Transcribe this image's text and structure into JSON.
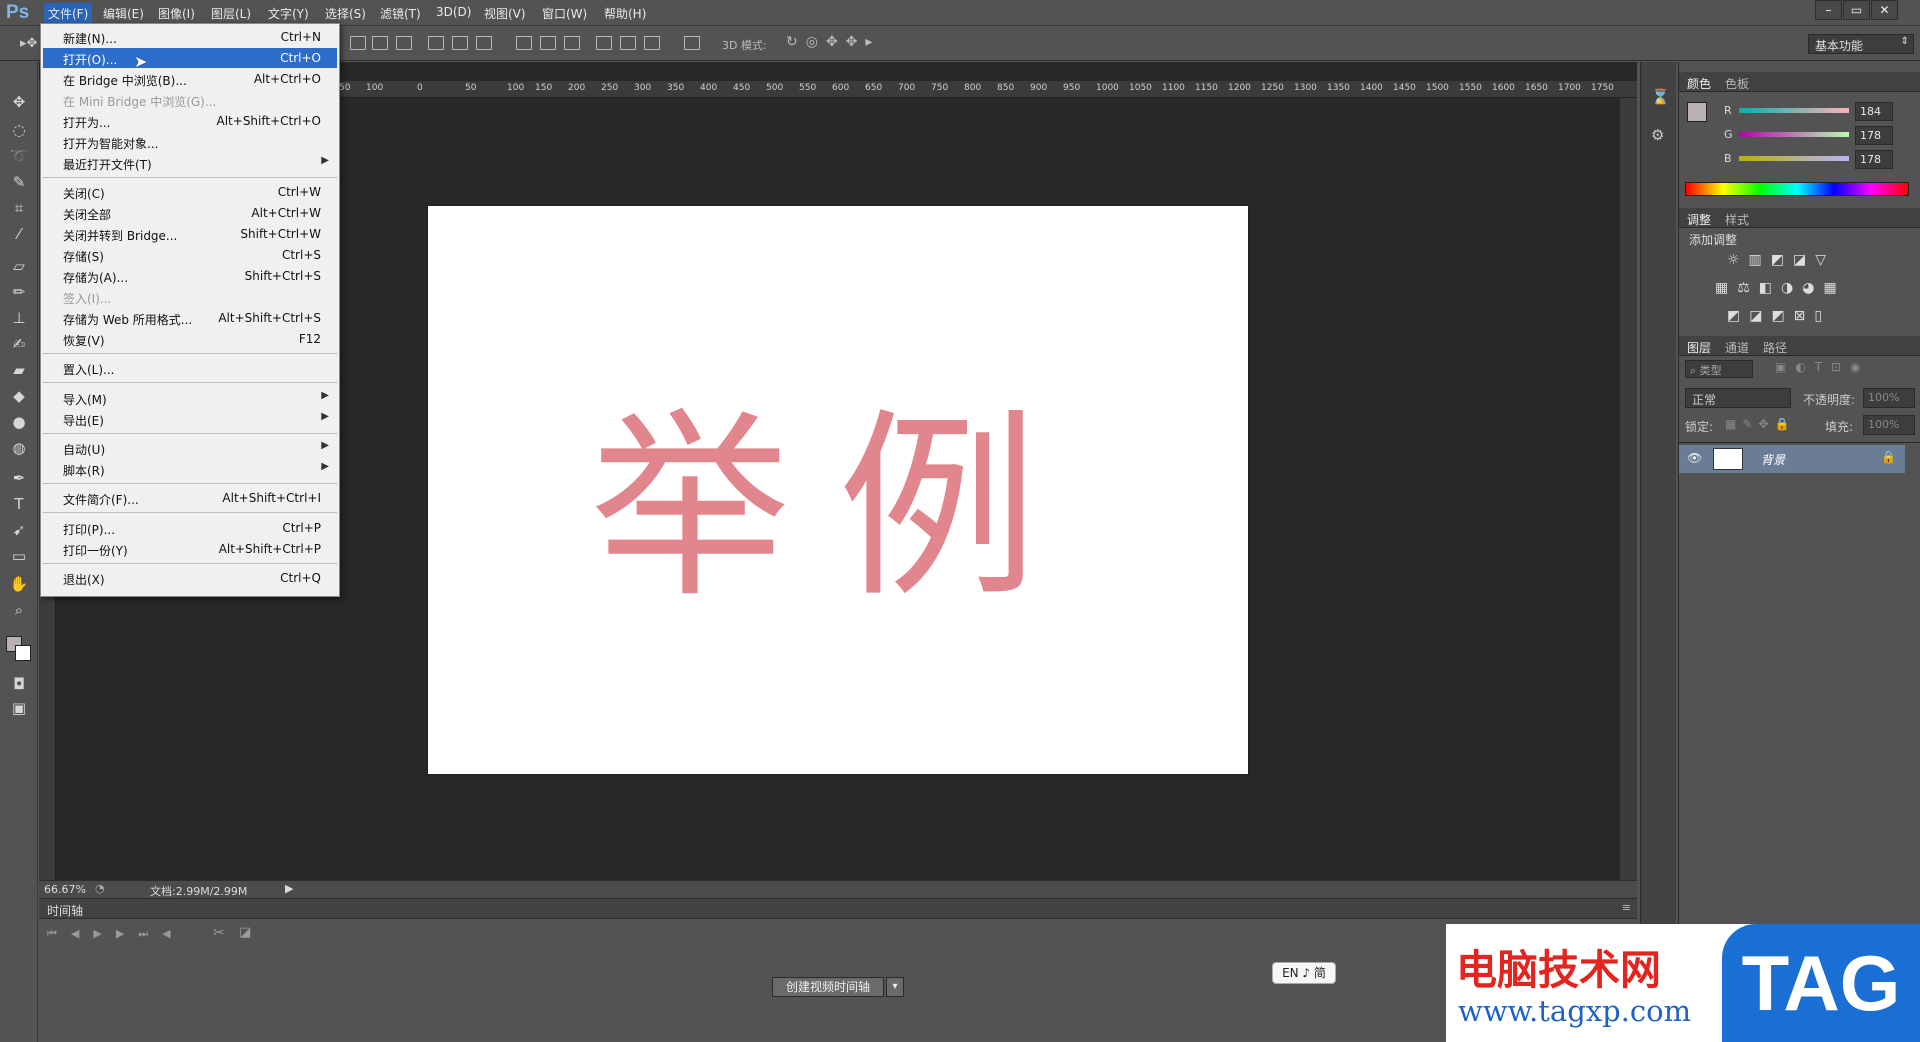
{
  "app": {
    "logo": "Ps"
  },
  "menubar": {
    "items": [
      "文件(F)",
      "编辑(E)",
      "图像(I)",
      "图层(L)",
      "文字(Y)",
      "选择(S)",
      "滤镜(T)",
      "3D(D)",
      "视图(V)",
      "窗口(W)",
      "帮助(H)"
    ],
    "active": "文件(F)",
    "window_controls": [
      "–",
      "▭",
      "✕"
    ]
  },
  "options_bar": {
    "mode_label": "3D 模式:",
    "workspace": "基本功能"
  },
  "ruler": {
    "ticks": [
      "50",
      "100",
      "150",
      "200",
      "250",
      "300",
      "350",
      "400",
      "450",
      "500",
      "550",
      "600",
      "650",
      "700",
      "750",
      "800",
      "850",
      "900",
      "950",
      "1000",
      "1050",
      "1100",
      "1150",
      "1200",
      "1250",
      "1300",
      "1350",
      "1400",
      "1450",
      "1500",
      "1550",
      "1600",
      "1650",
      "1700",
      "1750"
    ],
    "head_ticks": [
      "50",
      "100",
      "0",
      "50"
    ]
  },
  "canvas": {
    "text": "举例",
    "text_color": "#e2868d"
  },
  "status": {
    "zoom": "66.67%",
    "doc": "文档:2.99M/2.99M"
  },
  "timeline": {
    "tab": "时间轴",
    "create_button": "创建视频时间轴"
  },
  "color_panel": {
    "tabs": [
      "颜色",
      "色板"
    ],
    "channels": [
      {
        "name": "R",
        "value": "184"
      },
      {
        "name": "G",
        "value": "178"
      },
      {
        "name": "B",
        "value": "178"
      }
    ]
  },
  "adjust_panel": {
    "tabs": [
      "调整",
      "样式"
    ],
    "title": "添加调整"
  },
  "layers_panel": {
    "tabs": [
      "图层",
      "通道",
      "路径"
    ],
    "filter": "类型",
    "blend_mode": "正常",
    "opacity_label": "不透明度:",
    "opacity_value": "100%",
    "lock_label": "锁定:",
    "fill_label": "填充:",
    "fill_value": "100%",
    "layer_name": "背景"
  },
  "file_menu": {
    "items": [
      {
        "label": "新建(N)...",
        "shortcut": "Ctrl+N"
      },
      {
        "label": "打开(O)...",
        "shortcut": "Ctrl+O",
        "highlight": true
      },
      {
        "label": "在 Bridge 中浏览(B)...",
        "shortcut": "Alt+Ctrl+O"
      },
      {
        "label": "在 Mini Bridge 中浏览(G)...",
        "shortcut": "",
        "disabled": true
      },
      {
        "label": "打开为...",
        "shortcut": "Alt+Shift+Ctrl+O"
      },
      {
        "label": "打开为智能对象...",
        "shortcut": ""
      },
      {
        "label": "最近打开文件(T)",
        "shortcut": "",
        "submenu": true
      },
      {
        "label": "关闭(C)",
        "shortcut": "Ctrl+W"
      },
      {
        "label": "关闭全部",
        "shortcut": "Alt+Ctrl+W"
      },
      {
        "label": "关闭并转到 Bridge...",
        "shortcut": "Shift+Ctrl+W"
      },
      {
        "label": "存储(S)",
        "shortcut": "Ctrl+S"
      },
      {
        "label": "存储为(A)...",
        "shortcut": "Shift+Ctrl+S"
      },
      {
        "label": "签入(I)...",
        "shortcut": "",
        "disabled": true
      },
      {
        "label": "存储为 Web 所用格式...",
        "shortcut": "Alt+Shift+Ctrl+S"
      },
      {
        "label": "恢复(V)",
        "shortcut": "F12"
      },
      {
        "label": "置入(L)...",
        "shortcut": ""
      },
      {
        "label": "导入(M)",
        "shortcut": "",
        "submenu": true
      },
      {
        "label": "导出(E)",
        "shortcut": "",
        "submenu": true
      },
      {
        "label": "自动(U)",
        "shortcut": "",
        "submenu": true
      },
      {
        "label": "脚本(R)",
        "shortcut": "",
        "submenu": true
      },
      {
        "label": "文件简介(F)...",
        "shortcut": "Alt+Shift+Ctrl+I"
      },
      {
        "label": "打印(P)...",
        "shortcut": "Ctrl+P"
      },
      {
        "label": "打印一份(Y)",
        "shortcut": "Alt+Shift+Ctrl+P"
      },
      {
        "label": "退出(X)",
        "shortcut": "Ctrl+Q"
      }
    ]
  },
  "ime": {
    "text": "EN ♪ 简"
  },
  "watermark": {
    "title": "电脑技术网",
    "url": "www.tagxp.com",
    "tag": "TAG"
  },
  "icons": [
    "move-icon",
    "marquee-icon",
    "lasso-icon",
    "quick-select-icon",
    "crop-icon",
    "eyedropper-icon",
    "healing-icon",
    "brush-icon",
    "stamp-icon",
    "history-brush-icon",
    "eraser-icon",
    "paint-bucket-icon",
    "blur-icon",
    "dodge-icon",
    "pen-icon",
    "type-icon",
    "path-select-icon",
    "shape-icon",
    "hand-icon",
    "zoom-icon"
  ]
}
